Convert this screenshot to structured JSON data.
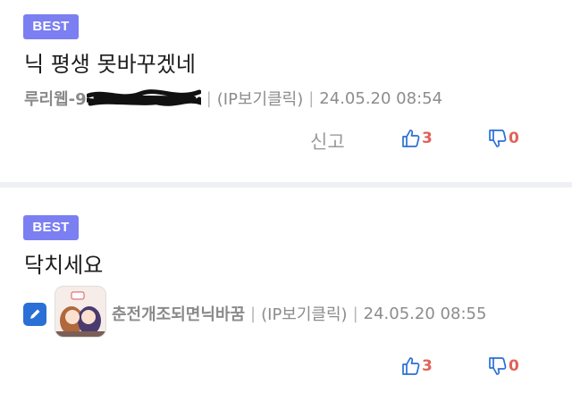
{
  "comments": [
    {
      "badge": "BEST",
      "text": "닉 평생 못바꾸겠네",
      "nickname": "루리웹-9",
      "ip_label": "(IP보기클릭)",
      "date": "24.05.20 08:54",
      "report_label": "신고",
      "upvotes": "3",
      "downvotes": "0"
    },
    {
      "badge": "BEST",
      "text": "닥치세요",
      "nickname": "춘전개조되면닉바꿈",
      "ip_label": "(IP보기클릭)",
      "date": "24.05.20 08:55",
      "upvotes": "3",
      "downvotes": "0"
    }
  ],
  "separator": "|",
  "colors": {
    "badge": "#7b7ff2",
    "vote": "#e0625a",
    "icon_blue": "#2a6fd6"
  },
  "icons": [
    "thumbs-up-icon",
    "thumbs-down-icon",
    "pencil-icon",
    "avatar-image"
  ]
}
